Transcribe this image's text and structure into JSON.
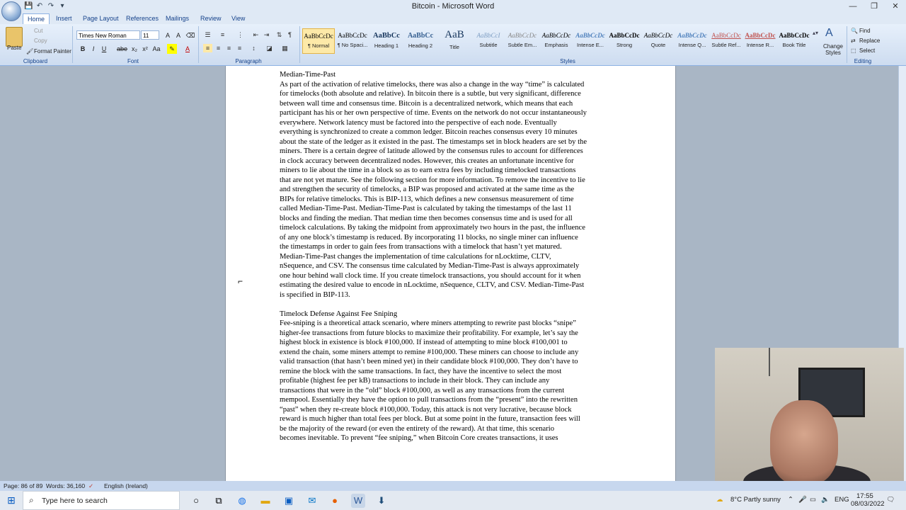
{
  "window": {
    "title": "Bitcoin - Microsoft Word",
    "controls": [
      "—",
      "❐",
      "✕"
    ]
  },
  "quick_access": [
    "💾",
    "↶",
    "↷",
    "▾"
  ],
  "tabs": [
    "Home",
    "Insert",
    "Page Layout",
    "References",
    "Mailings",
    "Review",
    "View"
  ],
  "ribbon": {
    "clipboard": {
      "paste": "Paste",
      "cut": "Cut",
      "copy": "Copy",
      "format_painter": "Format Painter",
      "label": "Clipboard"
    },
    "font": {
      "name": "Times New Roman",
      "size": "11",
      "label": "Font"
    },
    "paragraph": {
      "label": "Paragraph"
    },
    "styles": {
      "label": "Styles",
      "items": [
        {
          "sample": "AaBbCcDc",
          "name": "¶ Normal"
        },
        {
          "sample": "AaBbCcDc",
          "name": "¶ No Spaci..."
        },
        {
          "sample": "AaBbCc",
          "name": "Heading 1"
        },
        {
          "sample": "AaBbCc",
          "name": "Heading 2"
        },
        {
          "sample": "AaB",
          "name": "Title"
        },
        {
          "sample": "AaBbCcI",
          "name": "Subtitle"
        },
        {
          "sample": "AaBbCcDc",
          "name": "Subtle Em..."
        },
        {
          "sample": "AaBbCcDc",
          "name": "Emphasis"
        },
        {
          "sample": "AaBbCcDc",
          "name": "Intense E..."
        },
        {
          "sample": "AaBbCcDc",
          "name": "Strong"
        },
        {
          "sample": "AaBbCcDc",
          "name": "Quote"
        },
        {
          "sample": "AaBbCcDc",
          "name": "Intense Q..."
        },
        {
          "sample": "AaBbCcDc",
          "name": "Subtle Ref..."
        },
        {
          "sample": "AaBbCcDc",
          "name": "Intense R..."
        },
        {
          "sample": "AaBbCcDc",
          "name": "Book Title"
        }
      ],
      "change_styles": "Change Styles"
    },
    "editing": {
      "find": "Find",
      "replace": "Replace",
      "select": "Select",
      "label": "Editing"
    }
  },
  "document": {
    "lines": [
      "Median-Time-Past",
      "As part of the activation of relative timelocks, there was also a change in the way “time” is calculated",
      "for timelocks (both absolute and relative). In bitcoin there is a subtle, but very significant, difference",
      "between wall time and consensus time. Bitcoin is a decentralized network, which means that each",
      "participant has his or her own perspective of time. Events on the network do not occur instantaneously",
      "everywhere. Network latency must be factored into the perspective of each node. Eventually",
      "everything is synchronized to create a common ledger. Bitcoin reaches consensus every 10 minutes",
      "about the state of the ledger as it existed in the past. The timestamps set in block headers are set by the",
      "miners. There is a certain degree of latitude allowed by the consensus rules to account for differences",
      "in clock accuracy between decentralized nodes. However, this creates an unfortunate incentive for",
      "miners to lie about the time in a block so as to earn extra fees by including timelocked transactions",
      "that are not yet mature. See the following section for more information. To remove the incentive to lie",
      "and strengthen the security of timelocks, a BIP was proposed and activated at the same time as the",
      "BIPs for relative timelocks. This is BIP-113, which defines a new consensus measurement of time",
      "called Median-Time-Past. Median-Time-Past is calculated by taking the timestamps of the last 11",
      "blocks and finding the median. That median time then becomes consensus time and is used for all",
      "timelock calculations. By taking the midpoint from approximately two hours in the past, the influence",
      "of any one block’s timestamp is reduced. By incorporating 11 blocks, no single miner can influence",
      "the timestamps in order to gain fees from transactions with a timelock that hasn’t yet matured.",
      "Median-Time-Past changes the implementation of time calculations for nLocktime, CLTV,",
      "nSequence, and CSV. The consensus time calculated by Median-Time-Past is always approximately",
      "one hour behind wall clock time. If you create timelock transactions, you should account for it when",
      "estimating the desired value to encode in nLocktime, nSequence, CLTV, and CSV. Median-Time-Past",
      "is specified in BIP-113.",
      "",
      "Timelock Defense Against Fee Sniping",
      "Fee-sniping is a theoretical attack scenario, where miners attempting to rewrite past blocks “snipe”",
      "higher-fee transactions from future blocks to maximize their profitability. For example, let’s say the",
      "highest block in existence is block #100,000. If instead of attempting to mine block #100,001 to",
      "extend the chain, some miners attempt to remine #100,000. These miners can choose to include any",
      "valid transaction (that hasn’t been mined yet) in their candidate block #100,000. They don’t have to",
      "remine the block with the same transactions. In fact, they have the incentive to select the most",
      "profitable (highest fee per kB) transactions to include in their block. They can include any",
      "transactions that were in the “old” block #100,000, as well as any transactions from the current",
      "mempool. Essentially they have the option to pull transactions from the “present” into the rewritten",
      "“past” when they re-create block #100,000. Today, this attack is not very lucrative, because block",
      "reward is much higher than total fees per block. But at some point in the future, transaction fees will",
      "be the majority of the reward (or even the entirety of the reward). At that time, this scenario",
      "becomes inevitable. To prevent “fee sniping,” when Bitcoin Core creates transactions, it uses"
    ]
  },
  "status": {
    "page": "Page: 86 of 89",
    "words": "Words: 36,160",
    "language": "English (Ireland)"
  },
  "taskbar": {
    "search_placeholder": "Type here to search",
    "weather": "8°C  Partly sunny",
    "lang": "ENG",
    "time": "17:55",
    "date": "08/03/2022"
  }
}
